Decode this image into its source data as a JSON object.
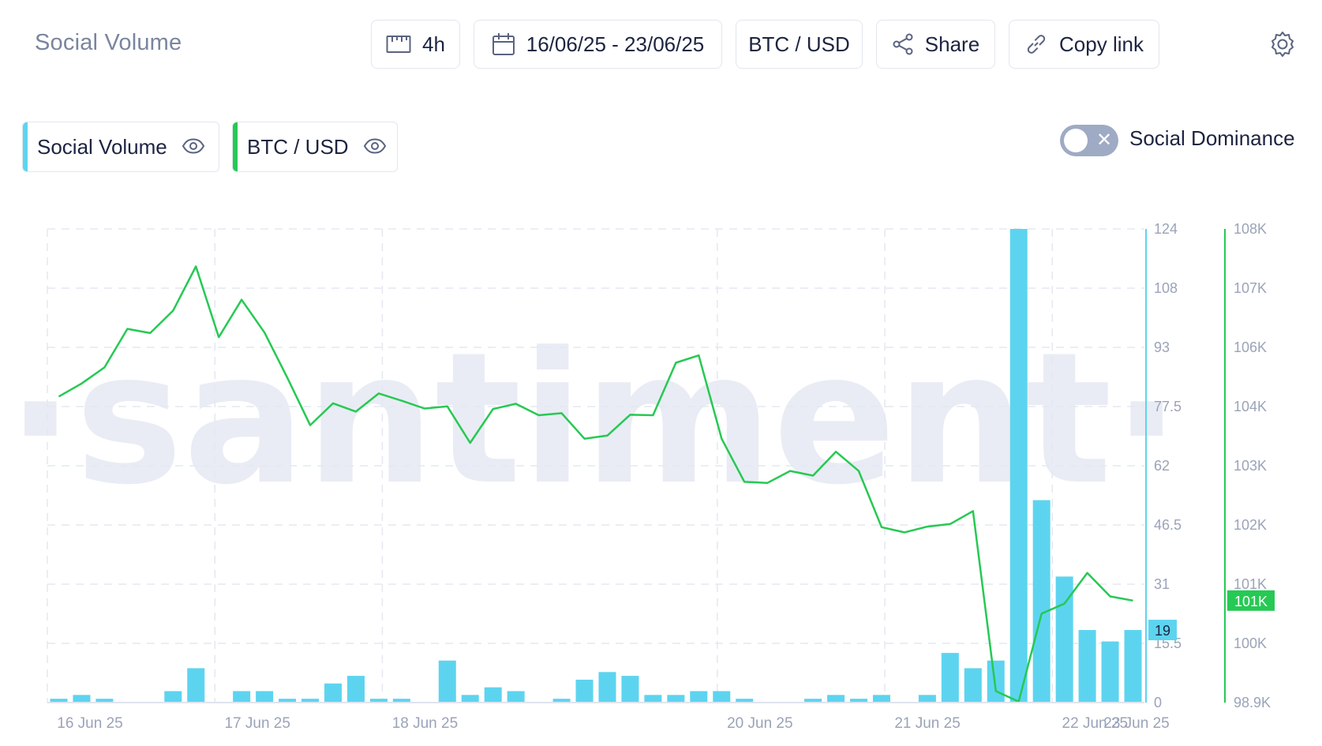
{
  "header": {
    "title": "Social Volume",
    "interval_label": "4h",
    "date_range_label": "16/06/25 - 23/06/25",
    "asset_label": "BTC / USD",
    "share_label": "Share",
    "copy_link_label": "Copy link"
  },
  "legend": {
    "items": [
      {
        "label": "Social Volume",
        "color": "#5dd4ef"
      },
      {
        "label": "BTC / USD",
        "color": "#26c953"
      }
    ],
    "toggle_label": "Social Dominance",
    "toggle_on": false
  },
  "watermark": "·santiment·",
  "chart_data": {
    "type": "bar+line",
    "x_labels": [
      "16 Jun 25",
      "17 Jun 25",
      "18 Jun 25",
      "20 Jun 25",
      "21 Jun 25",
      "22 Jun 25",
      "23 Jun 25"
    ],
    "series": [
      {
        "name": "Social Volume",
        "type": "bar",
        "axis": "left",
        "color": "#5dd4ef",
        "values": [
          1,
          2,
          1,
          0,
          0,
          3,
          9,
          0,
          3,
          3,
          1,
          1,
          5,
          7,
          1,
          1,
          0,
          11,
          2,
          4,
          3,
          0,
          1,
          6,
          8,
          7,
          2,
          2,
          3,
          3,
          1,
          0,
          0,
          1,
          2,
          1,
          2,
          0,
          2,
          13,
          9,
          11,
          124,
          53,
          33,
          19,
          16,
          19
        ],
        "axis_ticks": [
          "0",
          "15.5",
          "31",
          "46.5",
          "62",
          "77.5",
          "93",
          "108",
          "124"
        ],
        "ylim": [
          0,
          124
        ],
        "last_value_label": "19"
      },
      {
        "name": "BTC / USD",
        "type": "line",
        "axis": "right",
        "color": "#26c953",
        "values": [
          104780,
          105030,
          105340,
          106080,
          106000,
          106430,
          107280,
          105920,
          106640,
          106010,
          105140,
          104230,
          104650,
          104490,
          104840,
          104700,
          104550,
          104590,
          103890,
          104540,
          104640,
          104420,
          104460,
          103970,
          104030,
          104430,
          104420,
          105430,
          105570,
          103970,
          103140,
          103120,
          103350,
          103260,
          103720,
          103350,
          102270,
          102170,
          102280,
          102330,
          102580,
          99120,
          98920,
          100610,
          100800,
          101390,
          100940,
          100860
        ],
        "axis_ticks": [
          "98.9K",
          "100K",
          "101K",
          "102K",
          "103K",
          "104K",
          "106K",
          "107K",
          "108K"
        ],
        "ylim": [
          98900,
          108000
        ],
        "last_value_label": "101K"
      }
    ],
    "grid": true,
    "legend_position": "top-left"
  }
}
